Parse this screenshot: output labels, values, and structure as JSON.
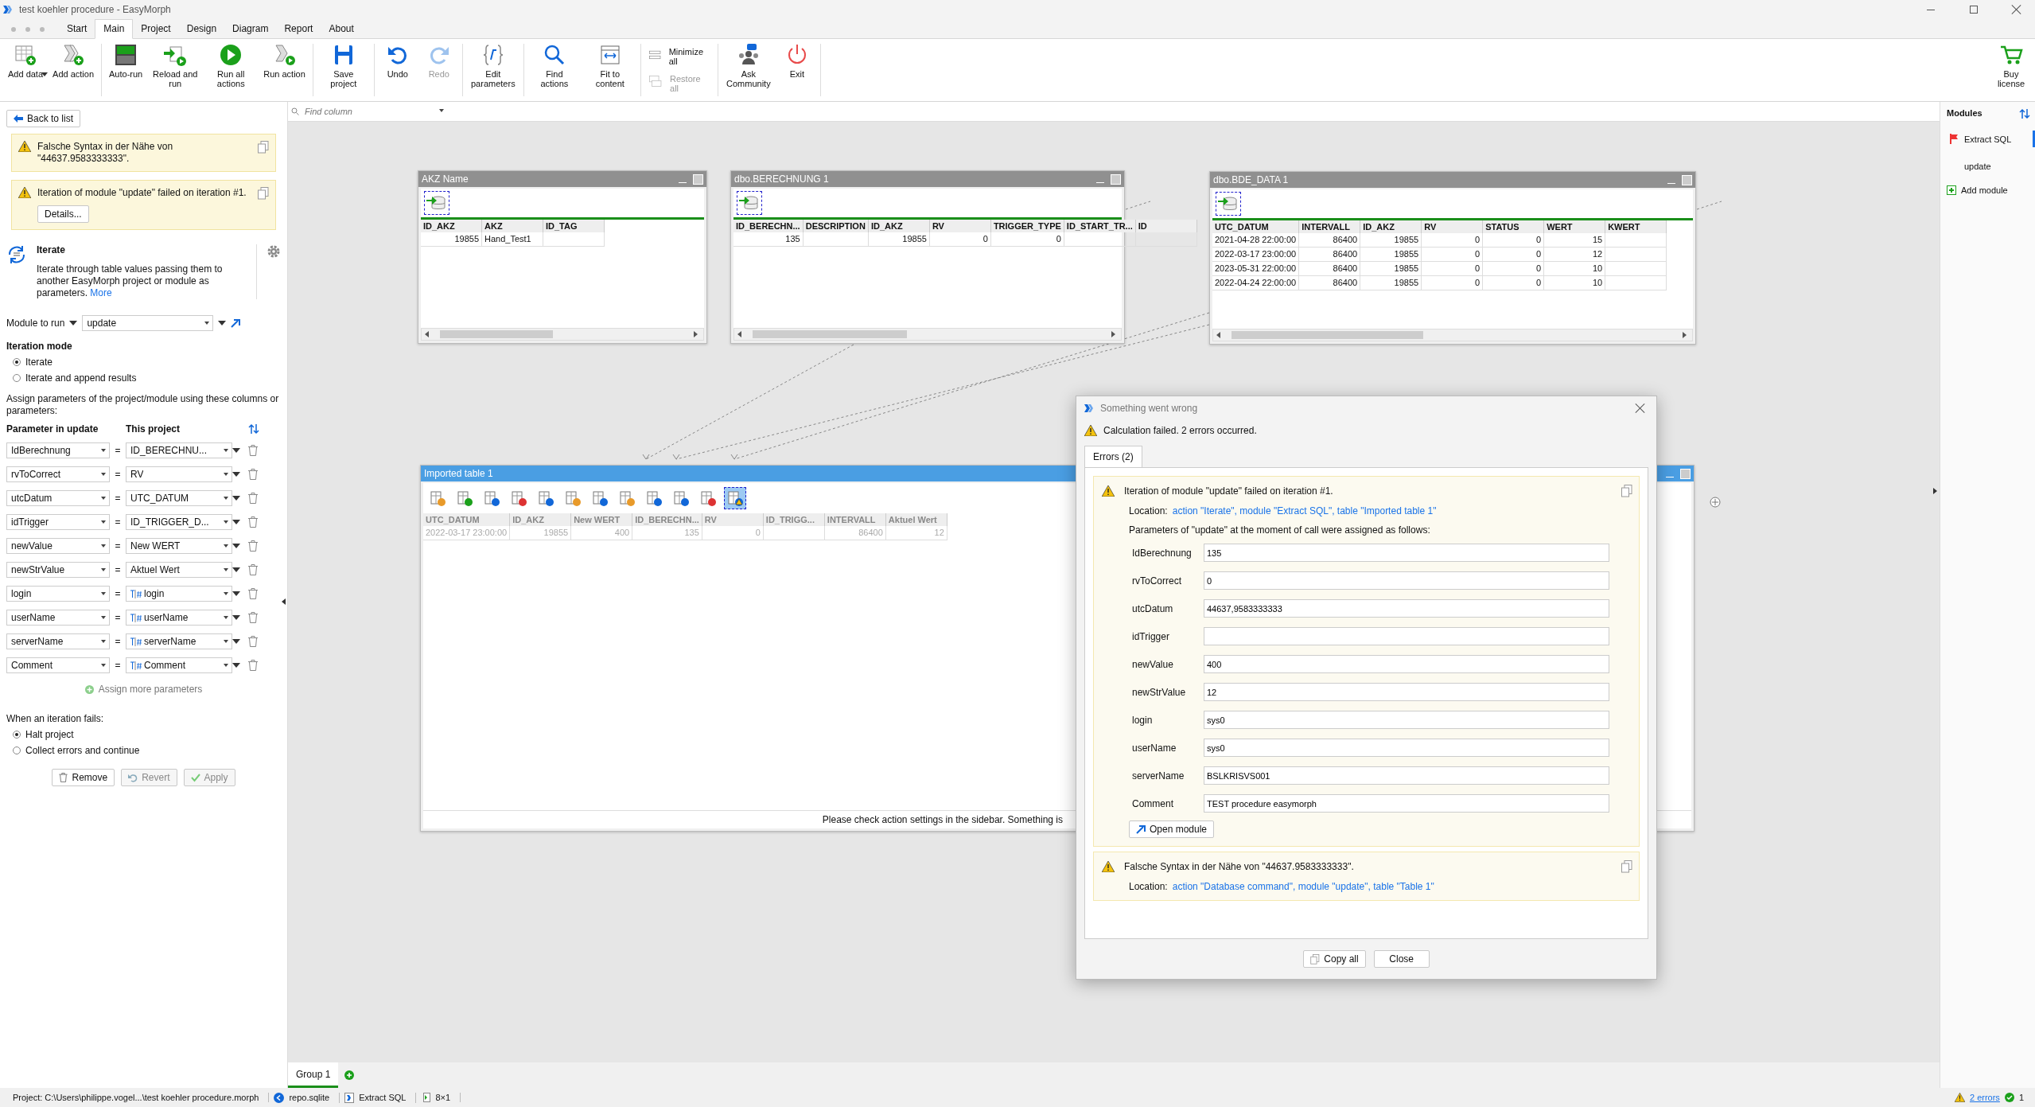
{
  "window": {
    "title": "test koehler procedure - EasyMorph"
  },
  "menu_tabs": [
    {
      "label": "Start",
      "selected": false
    },
    {
      "label": "Main",
      "selected": true
    },
    {
      "label": "Project",
      "selected": false
    },
    {
      "label": "Design",
      "selected": false
    },
    {
      "label": "Diagram",
      "selected": false
    },
    {
      "label": "Report",
      "selected": false
    },
    {
      "label": "About",
      "selected": false
    }
  ],
  "ribbon": [
    {
      "stacked": false,
      "items": [
        {
          "kind": "add-data",
          "label": "Add data",
          "dropdown": true,
          "disabled": false
        },
        {
          "kind": "add-action",
          "label": "Add action",
          "disabled": false
        }
      ]
    },
    {
      "stacked": false,
      "items": [
        {
          "kind": "auto-run",
          "label": "Auto-run",
          "disabled": false
        },
        {
          "kind": "reload-run",
          "label": "Reload and run",
          "disabled": false
        },
        {
          "kind": "run-all",
          "label": "Run all actions",
          "disabled": false
        },
        {
          "kind": "run-action",
          "label": "Run action",
          "disabled": false
        }
      ]
    },
    {
      "stacked": false,
      "items": [
        {
          "kind": "save",
          "label": "Save project",
          "disabled": false
        }
      ]
    },
    {
      "stacked": false,
      "items": [
        {
          "kind": "undo",
          "label": "Undo",
          "disabled": false
        },
        {
          "kind": "redo",
          "label": "Redo",
          "disabled": true
        }
      ]
    },
    {
      "stacked": false,
      "items": [
        {
          "kind": "edit-params",
          "label": "Edit parameters",
          "disabled": false
        }
      ]
    },
    {
      "stacked": false,
      "items": [
        {
          "kind": "find-actions",
          "label": "Find actions",
          "disabled": false
        },
        {
          "kind": "fit",
          "label": "Fit to content",
          "disabled": false
        }
      ]
    },
    {
      "stacked": true,
      "items": [
        {
          "kind": "minimize",
          "label": "Minimize all",
          "disabled": false
        },
        {
          "kind": "restore",
          "label": "Restore all",
          "disabled": true
        }
      ]
    },
    {
      "stacked": false,
      "items": [
        {
          "kind": "community",
          "label": "Ask Community",
          "disabled": false
        },
        {
          "kind": "exit",
          "label": "Exit",
          "disabled": false
        }
      ]
    }
  ],
  "buy_button": {
    "label": "Buy license"
  },
  "sidebar": {
    "back_button": "Back to list",
    "alerts": [
      {
        "text": "Falsche Syntax in der Nähe von \"44637.9583333333\"."
      },
      {
        "text": "Iteration of  module \"update\" failed on iteration #1.",
        "button": "Details..."
      }
    ],
    "action": {
      "title": "Iterate",
      "description": "Iterate through table values passing them to another EasyMorph project or module as parameters.",
      "link": "More"
    },
    "module": {
      "label": "Module to run",
      "value": "update"
    },
    "iteration_mode": {
      "title": "Iteration mode",
      "options": [
        {
          "label": "Iterate",
          "selected": true
        },
        {
          "label": "Iterate and append results",
          "selected": false
        }
      ]
    },
    "assign_text": "Assign parameters of the project/module using these columns or parameters:",
    "params_header": {
      "left": "Parameter in update",
      "right": "This project"
    },
    "params": [
      {
        "name": "IdBerechnung",
        "operator": "=",
        "source": "ID_BERECHNU...",
        "kind": "column"
      },
      {
        "name": "rvToCorrect",
        "operator": "=",
        "source": "RV",
        "kind": "column"
      },
      {
        "name": "utcDatum",
        "operator": "=",
        "source": "UTC_DATUM",
        "kind": "column"
      },
      {
        "name": "idTrigger",
        "operator": "=",
        "source": "ID_TRIGGER_D...",
        "kind": "column"
      },
      {
        "name": "newValue",
        "operator": "=",
        "source": "New WERT",
        "kind": "column"
      },
      {
        "name": "newStrValue",
        "operator": "=",
        "source": "Aktuel Wert",
        "kind": "column"
      },
      {
        "name": "login",
        "operator": "=",
        "source": "login",
        "kind": "parameter"
      },
      {
        "name": "userName",
        "operator": "=",
        "source": "userName",
        "kind": "parameter"
      },
      {
        "name": "serverName",
        "operator": "=",
        "source": "serverName",
        "kind": "parameter"
      },
      {
        "name": "Comment",
        "operator": "=",
        "source": "Comment",
        "kind": "parameter"
      }
    ],
    "assign_more": "Assign more parameters",
    "on_fail": {
      "title": "When an iteration fails:",
      "options": [
        {
          "label": "Halt project",
          "selected": true
        },
        {
          "label": "Collect errors and continue",
          "selected": false
        }
      ]
    },
    "buttons": [
      {
        "kind": "remove",
        "label": "Remove",
        "disabled": false
      },
      {
        "kind": "revert",
        "label": "Revert",
        "disabled": true
      },
      {
        "kind": "apply",
        "label": "Apply",
        "disabled": true
      }
    ]
  },
  "find_column": {
    "placeholder": "Find column"
  },
  "tables": [
    {
      "title": "AKZ Name",
      "active": false,
      "dimmed": false,
      "columns": [
        {
          "label": "ID_AKZ",
          "numeric": true
        },
        {
          "label": "AKZ",
          "numeric": false
        },
        {
          "label": "ID_TAG"
        }
      ],
      "rows": [
        [
          "19855",
          "Hand_Test1",
          null
        ]
      ]
    },
    {
      "title": "dbo.BERECHNUNG 1",
      "active": false,
      "dimmed": false,
      "columns": [
        {
          "label": "ID_BERECHN...",
          "numeric": true
        },
        {
          "label": "DESCRIPTION"
        },
        {
          "label": "ID_AKZ",
          "numeric": true
        },
        {
          "label": "RV",
          "numeric": true
        },
        {
          "label": "TRIGGER_TYPE",
          "numeric": true
        },
        {
          "label": "ID_START_TR..."
        },
        {
          "label": "ID"
        }
      ],
      "rows": [
        [
          "135",
          null,
          "19855",
          "0",
          "0",
          null,
          null
        ]
      ]
    },
    {
      "title": "dbo.BDE_DATA 1",
      "active": false,
      "dimmed": false,
      "columns": [
        {
          "label": "UTC_DATUM"
        },
        {
          "label": "INTERVALL",
          "numeric": true
        },
        {
          "label": "ID_AKZ",
          "numeric": true
        },
        {
          "label": "RV",
          "numeric": true
        },
        {
          "label": "STATUS",
          "numeric": true
        },
        {
          "label": "WERT",
          "numeric": true
        },
        {
          "label": "KWERT"
        }
      ],
      "rows": [
        [
          "2021-04-28 22:00:00",
          "86400",
          "19855",
          "0",
          "0",
          "15",
          null
        ],
        [
          "2022-03-17 23:00:00",
          "86400",
          "19855",
          "0",
          "0",
          "12",
          null
        ],
        [
          "2023-05-31 22:00:00",
          "86400",
          "19855",
          "0",
          "0",
          "10",
          null
        ],
        [
          "2022-04-24 22:00:00",
          "86400",
          "19855",
          "0",
          "0",
          "10",
          null
        ]
      ]
    },
    {
      "title": "Imported table 1",
      "active": true,
      "dimmed": true,
      "columns": [
        {
          "label": "UTC_DATUM"
        },
        {
          "label": "ID_AKZ",
          "numeric": true
        },
        {
          "label": "New WERT",
          "numeric": true
        },
        {
          "label": "ID_BERECHN...",
          "numeric": true
        },
        {
          "label": "RV",
          "numeric": true
        },
        {
          "label": "ID_TRIGG..."
        },
        {
          "label": "INTERVALL",
          "numeric": true
        },
        {
          "label": "Aktuel Wert",
          "numeric": true
        }
      ],
      "rows": [
        [
          "2022-03-17 23:00:00",
          "19855",
          "400",
          "135",
          "0",
          null,
          "86400",
          "12"
        ]
      ],
      "toolbar": [
        {
          "selected": false
        },
        {
          "selected": false
        },
        {
          "selected": false
        },
        {
          "selected": false
        },
        {
          "selected": false
        },
        {
          "selected": false
        },
        {
          "selected": false
        },
        {
          "selected": false
        },
        {
          "selected": false
        },
        {
          "selected": false
        },
        {
          "selected": false
        },
        {
          "selected": true
        }
      ],
      "message": "Please check action settings in the sidebar. Something is"
    }
  ],
  "modules": {
    "title": "Modules",
    "items": [
      {
        "label": "Extract SQL",
        "selected": true,
        "flagged": true
      },
      {
        "label": "update",
        "selected": false,
        "flagged": false
      }
    ],
    "add": "Add module"
  },
  "group_tabs": [
    {
      "label": "Group 1",
      "selected": true
    }
  ],
  "status_bar": {
    "project": "Project:  C:\\Users\\philippe.vogel...\\test koehler procedure.morph",
    "repo": "repo.sqlite",
    "module": "Extract SQL",
    "size": "8×1",
    "errors": "2 errors",
    "warnings": "1"
  },
  "dialog": {
    "title": "Something went wrong",
    "summary": "Calculation failed. 2 errors occurred.",
    "tab": "Errors (2)",
    "errors": [
      {
        "message": "Iteration of  module \"update\" failed on iteration #1.",
        "location_label": "Location:",
        "location": "action \"Iterate\", module \"Extract SQL\", table \"Imported table 1\"",
        "params_intro": "Parameters of \"update\" at the moment of call were assigned as follows:",
        "params": [
          {
            "name": "IdBerechnung",
            "value": "135"
          },
          {
            "name": "rvToCorrect",
            "value": "0"
          },
          {
            "name": "utcDatum",
            "value": "44637,9583333333"
          },
          {
            "name": "idTrigger"
          },
          {
            "name": "newValue",
            "value": "400"
          },
          {
            "name": "newStrValue",
            "value": "12"
          },
          {
            "name": "login",
            "value": "sys0"
          },
          {
            "name": "userName",
            "value": "sys0"
          },
          {
            "name": "serverName",
            "value": "BSLKRISVS001"
          },
          {
            "name": "Comment",
            "value": "TEST procedure easymorph"
          }
        ],
        "button": "Open module"
      },
      {
        "message": "Falsche Syntax in der Nähe von \"44637.9583333333\".",
        "location_label": "Location:",
        "location": "action \"Database command\", module \"update\", table \"Table 1\""
      }
    ],
    "buttons": [
      {
        "kind": "copy",
        "label": "Copy all"
      },
      {
        "kind": "close",
        "label": "Close"
      }
    ]
  }
}
